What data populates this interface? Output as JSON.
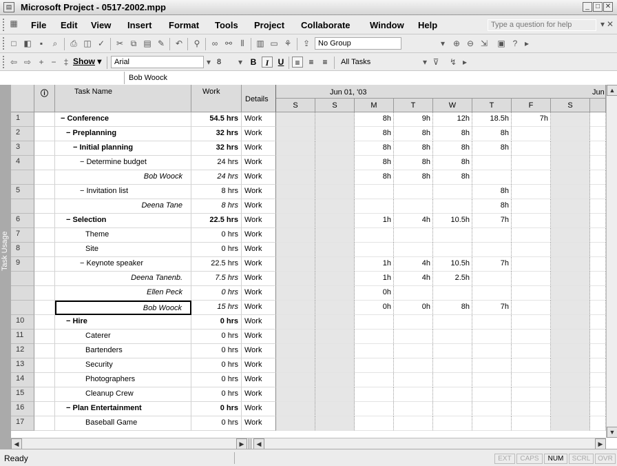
{
  "window": {
    "title": "Microsoft Project - 0517-2002.mpp",
    "controls": [
      "_",
      "□",
      "✕"
    ]
  },
  "menu": {
    "items": [
      "File",
      "Edit",
      "View",
      "Insert",
      "Format",
      "Tools",
      "Project",
      "Collaborate",
      "Window",
      "Help"
    ],
    "help_placeholder": "Type a question for help"
  },
  "toolbar": {
    "group_value": "No Group",
    "show_label": "Show",
    "font_value": "Arial",
    "size_value": "8",
    "filter_value": "All Tasks",
    "bold": "B",
    "italic": "I",
    "underline": "U"
  },
  "entry_bar": {
    "value": "Bob Woock"
  },
  "side_label": "Task Usage",
  "columns": {
    "info": "ⓘ",
    "task_name": "Task Name",
    "work": "Work",
    "details": "Details"
  },
  "timescale": {
    "week1": "Jun 01, '03",
    "week2": "Jun",
    "days": [
      "S",
      "S",
      "M",
      "T",
      "W",
      "T",
      "F",
      "S"
    ]
  },
  "rows": [
    {
      "id": "1",
      "name": "− Conference",
      "work": "54.5 hrs",
      "details": "Work",
      "style": "summary",
      "indent": 0,
      "days": [
        "",
        "",
        "8h",
        "9h",
        "12h",
        "18.5h",
        "7h",
        ""
      ]
    },
    {
      "id": "2",
      "name": "− Preplanning",
      "work": "32 hrs",
      "details": "Work",
      "style": "summary",
      "indent": 1,
      "days": [
        "",
        "",
        "8h",
        "8h",
        "8h",
        "8h",
        "",
        ""
      ]
    },
    {
      "id": "3",
      "name": "− Initial planning",
      "work": "32 hrs",
      "details": "Work",
      "style": "summary",
      "indent": 2,
      "days": [
        "",
        "",
        "8h",
        "8h",
        "8h",
        "8h",
        "",
        ""
      ]
    },
    {
      "id": "4",
      "name": "− Determine budget",
      "work": "24 hrs",
      "details": "Work",
      "style": "task",
      "indent": 3,
      "days": [
        "",
        "",
        "8h",
        "8h",
        "8h",
        "",
        "",
        ""
      ]
    },
    {
      "id": "",
      "name": "Bob Woock",
      "work": "24 hrs",
      "details": "Work",
      "style": "assign",
      "indent": 0,
      "days": [
        "",
        "",
        "8h",
        "8h",
        "8h",
        "",
        "",
        ""
      ]
    },
    {
      "id": "5",
      "name": "− Invitation list",
      "work": "8 hrs",
      "details": "Work",
      "style": "task",
      "indent": 3,
      "days": [
        "",
        "",
        "",
        "",
        "",
        "8h",
        "",
        ""
      ]
    },
    {
      "id": "",
      "name": "Deena Tane",
      "work": "8 hrs",
      "details": "Work",
      "style": "assign",
      "indent": 0,
      "days": [
        "",
        "",
        "",
        "",
        "",
        "8h",
        "",
        ""
      ]
    },
    {
      "id": "6",
      "name": "− Selection",
      "work": "22.5 hrs",
      "details": "Work",
      "style": "summary",
      "indent": 1,
      "days": [
        "",
        "",
        "1h",
        "4h",
        "10.5h",
        "7h",
        "",
        ""
      ]
    },
    {
      "id": "7",
      "name": "Theme",
      "work": "0 hrs",
      "details": "Work",
      "style": "task",
      "indent": 4,
      "days": [
        "",
        "",
        "",
        "",
        "",
        "",
        "",
        ""
      ]
    },
    {
      "id": "8",
      "name": "Site",
      "work": "0 hrs",
      "details": "Work",
      "style": "task",
      "indent": 4,
      "days": [
        "",
        "",
        "",
        "",
        "",
        "",
        "",
        ""
      ]
    },
    {
      "id": "9",
      "name": "− Keynote speaker",
      "work": "22.5 hrs",
      "details": "Work",
      "style": "task",
      "indent": 3,
      "days": [
        "",
        "",
        "1h",
        "4h",
        "10.5h",
        "7h",
        "",
        ""
      ]
    },
    {
      "id": "",
      "name": "Deena Tanenb.",
      "work": "7.5 hrs",
      "details": "Work",
      "style": "assign",
      "indent": 0,
      "days": [
        "",
        "",
        "1h",
        "4h",
        "2.5h",
        "",
        "",
        ""
      ]
    },
    {
      "id": "",
      "name": "Ellen Peck",
      "work": "0 hrs",
      "details": "Work",
      "style": "assign",
      "indent": 0,
      "days": [
        "",
        "",
        "0h",
        "",
        "",
        "",
        "",
        ""
      ]
    },
    {
      "id": "",
      "name": "Bob Woock",
      "work": "15 hrs",
      "details": "Work",
      "style": "assign",
      "indent": 0,
      "days": [
        "",
        "",
        "0h",
        "0h",
        "8h",
        "7h",
        "",
        ""
      ]
    },
    {
      "id": "10",
      "name": "− Hire",
      "work": "0 hrs",
      "details": "Work",
      "style": "summary",
      "indent": 1,
      "days": [
        "",
        "",
        "",
        "",
        "",
        "",
        "",
        ""
      ]
    },
    {
      "id": "11",
      "name": "Caterer",
      "work": "0 hrs",
      "details": "Work",
      "style": "task",
      "indent": 4,
      "days": [
        "",
        "",
        "",
        "",
        "",
        "",
        "",
        ""
      ]
    },
    {
      "id": "12",
      "name": "Bartenders",
      "work": "0 hrs",
      "details": "Work",
      "style": "task",
      "indent": 4,
      "days": [
        "",
        "",
        "",
        "",
        "",
        "",
        "",
        ""
      ]
    },
    {
      "id": "13",
      "name": "Security",
      "work": "0 hrs",
      "details": "Work",
      "style": "task",
      "indent": 4,
      "days": [
        "",
        "",
        "",
        "",
        "",
        "",
        "",
        ""
      ]
    },
    {
      "id": "14",
      "name": "Photographers",
      "work": "0 hrs",
      "details": "Work",
      "style": "task",
      "indent": 4,
      "days": [
        "",
        "",
        "",
        "",
        "",
        "",
        "",
        ""
      ]
    },
    {
      "id": "15",
      "name": "Cleanup Crew",
      "work": "0 hrs",
      "details": "Work",
      "style": "task",
      "indent": 4,
      "days": [
        "",
        "",
        "",
        "",
        "",
        "",
        "",
        ""
      ]
    },
    {
      "id": "16",
      "name": "− Plan Entertainment",
      "work": "0 hrs",
      "details": "Work",
      "style": "summary",
      "indent": 1,
      "days": [
        "",
        "",
        "",
        "",
        "",
        "",
        "",
        ""
      ]
    },
    {
      "id": "17",
      "name": "Baseball Game",
      "work": "0 hrs",
      "details": "Work",
      "style": "task",
      "indent": 4,
      "days": [
        "",
        "",
        "",
        "",
        "",
        "",
        "",
        ""
      ]
    }
  ],
  "status": {
    "text": "Ready",
    "indicators": [
      "EXT",
      "CAPS",
      "NUM",
      "SCRL",
      "OVR"
    ],
    "active": "NUM"
  }
}
